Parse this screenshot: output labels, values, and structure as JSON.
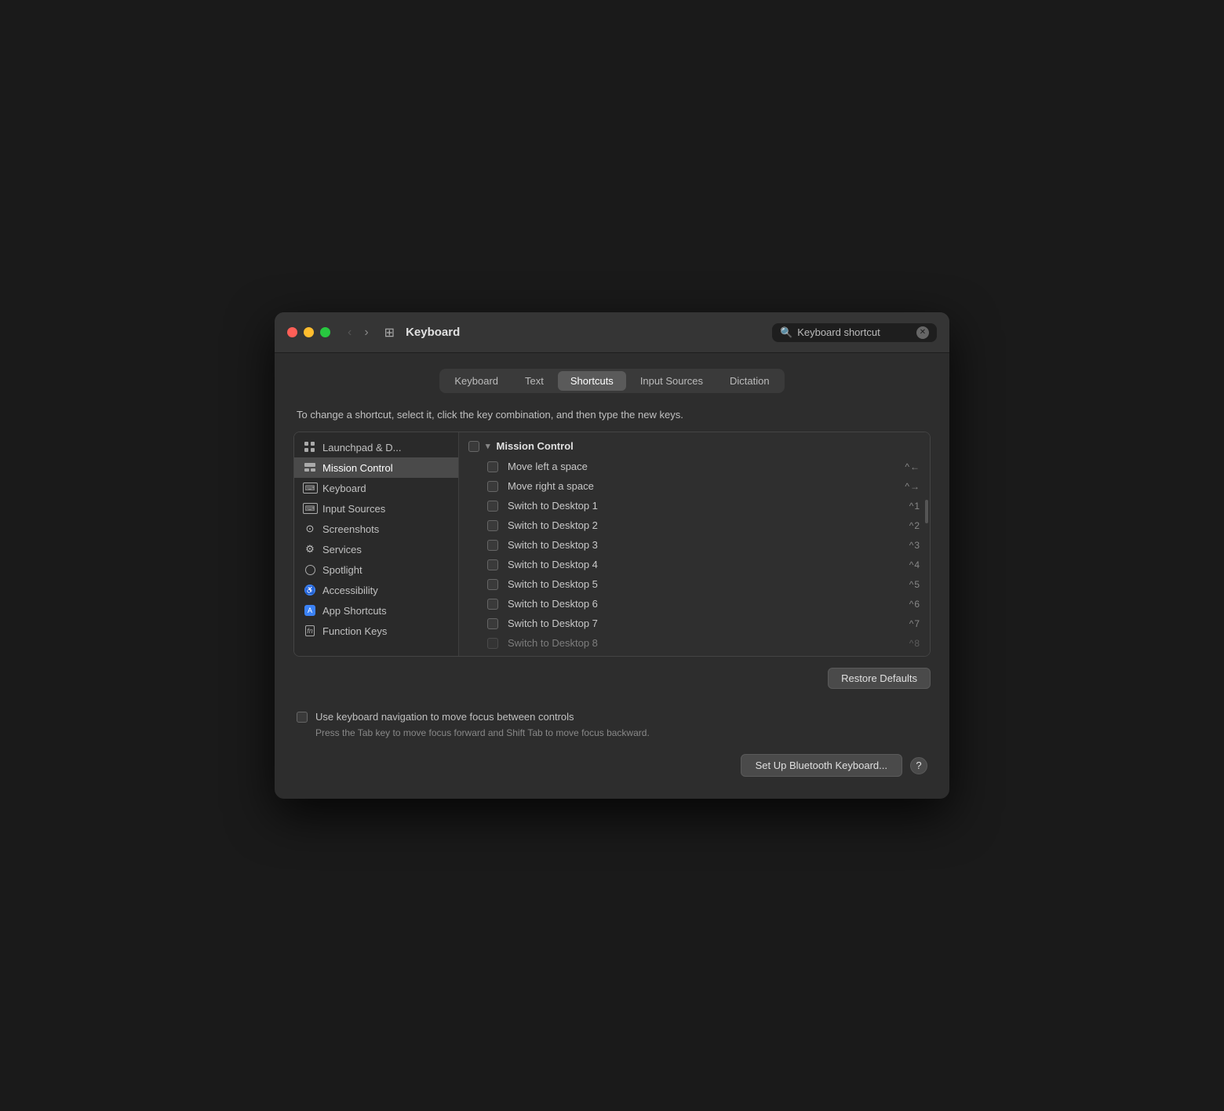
{
  "window": {
    "title": "Keyboard",
    "search_placeholder": "Keyboard shortcut"
  },
  "tabs": [
    {
      "id": "keyboard",
      "label": "Keyboard",
      "active": false
    },
    {
      "id": "text",
      "label": "Text",
      "active": false
    },
    {
      "id": "shortcuts",
      "label": "Shortcuts",
      "active": true
    },
    {
      "id": "input-sources",
      "label": "Input Sources",
      "active": false
    },
    {
      "id": "dictation",
      "label": "Dictation",
      "active": false
    }
  ],
  "instruction": "To change a shortcut, select it, click the key combination, and then type the new keys.",
  "sidebar": {
    "items": [
      {
        "id": "launchpad",
        "label": "Launchpad & D...",
        "icon": "grid"
      },
      {
        "id": "mission-control",
        "label": "Mission Control",
        "icon": "mission",
        "active": true
      },
      {
        "id": "keyboard",
        "label": "Keyboard",
        "icon": "kbd"
      },
      {
        "id": "input-sources",
        "label": "Input Sources",
        "icon": "kbd"
      },
      {
        "id": "screenshots",
        "label": "Screenshots",
        "icon": "screenshot"
      },
      {
        "id": "services",
        "label": "Services",
        "icon": "gear"
      },
      {
        "id": "spotlight",
        "label": "Spotlight",
        "icon": "circle"
      },
      {
        "id": "accessibility",
        "label": "Accessibility",
        "icon": "accessibility"
      },
      {
        "id": "app-shortcuts",
        "label": "App Shortcuts",
        "icon": "appshortcuts"
      },
      {
        "id": "function-keys",
        "label": "Function Keys",
        "icon": "fn"
      }
    ]
  },
  "shortcuts": {
    "section": "Mission Control",
    "items": [
      {
        "label": "Move left a space",
        "shortcut": "^←"
      },
      {
        "label": "Move right a space",
        "shortcut": "^→"
      },
      {
        "label": "Switch to Desktop 1",
        "shortcut": "^1"
      },
      {
        "label": "Switch to Desktop 2",
        "shortcut": "^2"
      },
      {
        "label": "Switch to Desktop 3",
        "shortcut": "^3"
      },
      {
        "label": "Switch to Desktop 4",
        "shortcut": "^4"
      },
      {
        "label": "Switch to Desktop 5",
        "shortcut": "^5"
      },
      {
        "label": "Switch to Desktop 6",
        "shortcut": "^6"
      },
      {
        "label": "Switch to Desktop 7",
        "shortcut": "^7"
      },
      {
        "label": "Switch to Desktop 8",
        "shortcut": "^8"
      }
    ]
  },
  "buttons": {
    "restore_defaults": "Restore Defaults",
    "set_up_bluetooth": "Set Up Bluetooth Keyboard...",
    "help": "?"
  },
  "bottom": {
    "nav_label": "Use keyboard navigation to move focus between controls",
    "nav_sublabel": "Press the Tab key to move focus forward and Shift Tab to move focus backward."
  }
}
